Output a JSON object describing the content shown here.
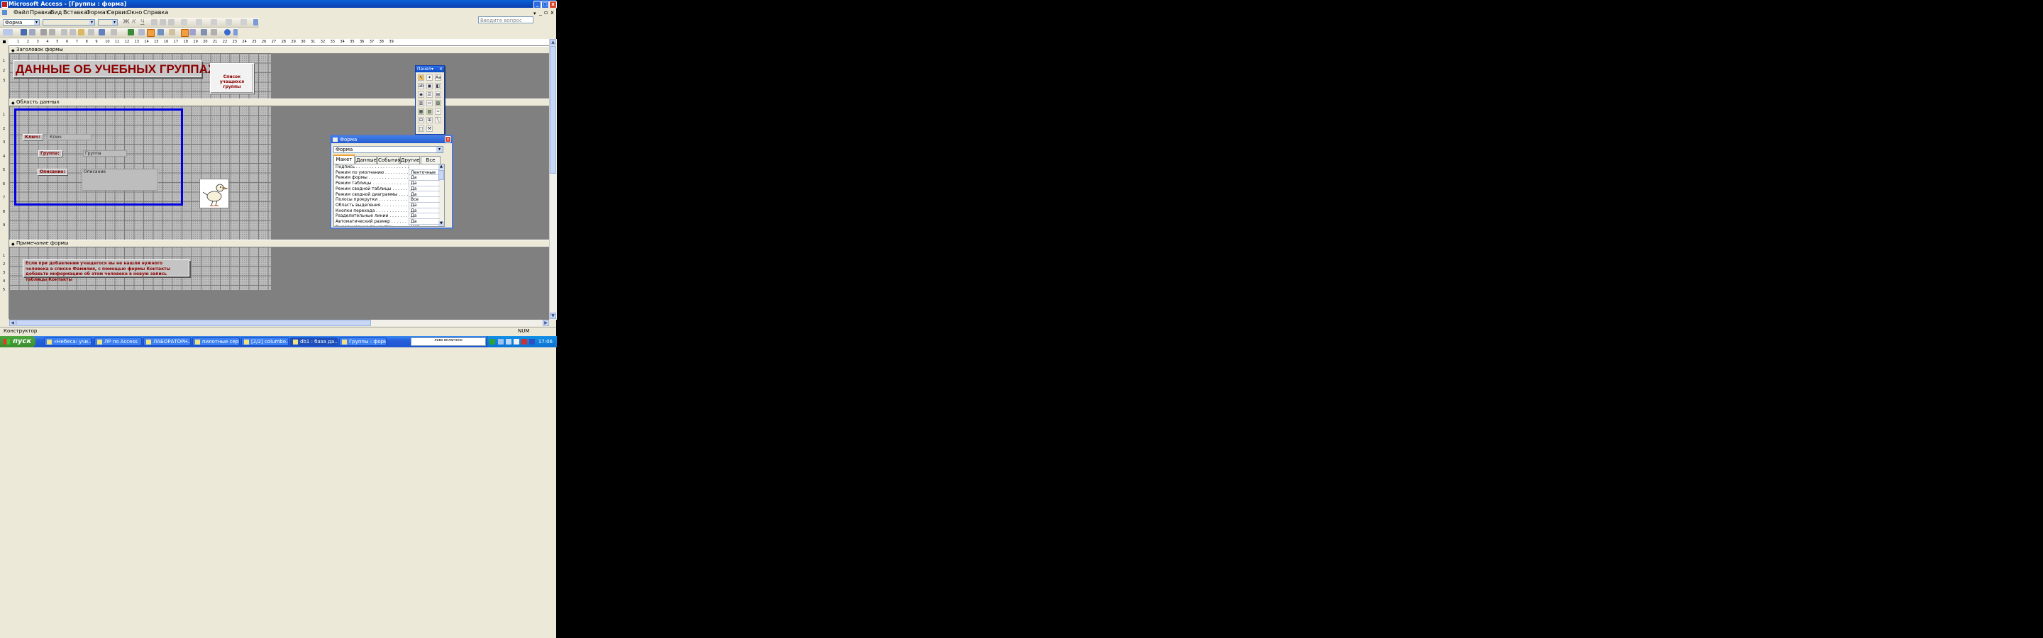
{
  "window": {
    "title": "Microsoft Access - [Группы : форма]",
    "controls": {
      "minimize": "_",
      "maximize": "□",
      "close": "x"
    },
    "inner_controls": {
      "minimize": "_",
      "restore": "▫",
      "close": "x"
    }
  },
  "menu": {
    "items": [
      "Файл",
      "Правка",
      "Вид",
      "Вставка",
      "Формат",
      "Сервис",
      "Окно",
      "Справка"
    ],
    "ask_placeholder": "Введите вопрос"
  },
  "formatting_toolbar": {
    "object_combo": "Форма",
    "font_combo": "",
    "size_combo": "",
    "bold": "Ж",
    "italic": "К",
    "underline": "Ч"
  },
  "ruler": {
    "horizontal_ticks": [
      "1",
      "2",
      "3",
      "4",
      "5",
      "6",
      "7",
      "8",
      "9",
      "10",
      "11",
      "12",
      "13",
      "14",
      "15",
      "16",
      "17",
      "18",
      "19",
      "20",
      "21",
      "22",
      "23",
      "24",
      "25",
      "26",
      "27",
      "28",
      "29",
      "30",
      "31",
      "32",
      "33",
      "34",
      "35",
      "36",
      "37",
      "38",
      "39"
    ],
    "vertical_ticks_header": [
      "1",
      "2",
      "3"
    ],
    "vertical_ticks_detail": [
      "1",
      "2",
      "3",
      "4",
      "5",
      "6",
      "7",
      "8",
      "9"
    ],
    "vertical_ticks_footer": [
      "1",
      "2",
      "3",
      "4",
      "5"
    ]
  },
  "sections": {
    "header": {
      "label": "Заголовок формы",
      "title": "ДАННЫЕ ОБ УЧЕБНЫХ ГРУППАХ",
      "button": "Список учащихся группы"
    },
    "detail": {
      "label": "Область данных",
      "fields": [
        {
          "label": "Ключ:",
          "control": "Ключ"
        },
        {
          "label": "Группа:",
          "control": "Группа"
        },
        {
          "label": "Описание:",
          "control": "Описание"
        }
      ]
    },
    "footer": {
      "label": "Примечание формы",
      "note": "Если при добавлении учащегося вы не нашли нужного человека в списке Фамилия, с помощью формы Контакты добавьте информацию об этом человеке в новую запись таблицы Контакты"
    }
  },
  "toolbox": {
    "title": "Панел",
    "close": "✕",
    "tools": [
      "select-objects",
      "wizard",
      "label",
      "textbox",
      "option-group",
      "toggle",
      "option-button",
      "checkbox",
      "combo-box",
      "list-box",
      "command-button",
      "image",
      "unbound-frame",
      "bound-frame",
      "page-break",
      "tab-control",
      "subform",
      "line",
      "rectangle",
      "more-controls"
    ]
  },
  "property_sheet": {
    "title": "Форма",
    "close": "x",
    "object_combo": "Форма",
    "tabs": [
      "Макет",
      "Данные",
      "События",
      "Другие",
      "Все"
    ],
    "active_tab": "Макет",
    "rows": [
      {
        "name": "Подпись . . . . . . . . . . . . . . . . . . . . .",
        "value": ""
      },
      {
        "name": "Режим по умолчанию . . . . . . . . . .",
        "value": "Ленточные"
      },
      {
        "name": "Режим формы . . . . . . . . . . . . . . . .",
        "value": "Да"
      },
      {
        "name": "Режим таблицы . . . . . . . . . . . . . .",
        "value": "Да"
      },
      {
        "name": "Режим сводной таблицы . . . . . . .",
        "value": "Да"
      },
      {
        "name": "Режим сводной диаграммы . . . . .",
        "value": "Да"
      },
      {
        "name": "Полосы прокрутки . . . . . . . . . . .",
        "value": "Все"
      },
      {
        "name": "Область выделения . . . . . . . . . .",
        "value": "Да"
      },
      {
        "name": "Кнопки перехода . . . . . . . . . . . .",
        "value": "Да"
      },
      {
        "name": "Разделительные линии . . . . . . .",
        "value": "Да"
      },
      {
        "name": "Автоматический размер . . . . . .",
        "value": "Да"
      },
      {
        "name": "Выравнивание по центру . . . . .",
        "value": "Нет"
      }
    ]
  },
  "statusbar": {
    "mode": "Конструктор",
    "num": "NUM"
  },
  "taskbar": {
    "start": "пуск",
    "tasks": [
      {
        "label": "«Небеса: учи...",
        "active": false
      },
      {
        "label": "ЛР по Access",
        "active": false
      },
      {
        "label": "ЛАБОРАТОРН...",
        "active": false
      },
      {
        "label": "пилотные серии",
        "active": false
      },
      {
        "label": "[2/2] columbo....",
        "active": false
      },
      {
        "label": "db1 : база да...",
        "active": true
      },
      {
        "label": "Группы : форма",
        "active": false
      }
    ],
    "lang_panel": "лево\nвключено",
    "clock": "17:06"
  },
  "colors": {
    "accent_blue": "#0a3fb0",
    "form_text_dark_red": "#8b0000",
    "selection_blue": "#0000e0",
    "start_green": "#3a8e2c"
  }
}
